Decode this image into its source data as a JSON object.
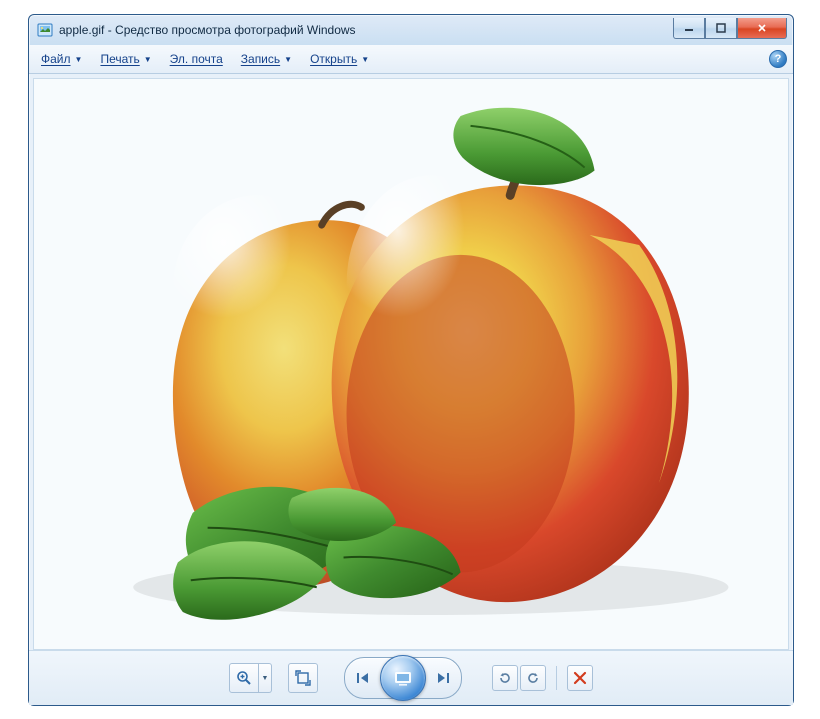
{
  "window": {
    "title": "apple.gif - Средство просмотра фотографий Windows"
  },
  "menu": {
    "file": "Файл",
    "print": "Печать",
    "email": "Эл. почта",
    "burn": "Запись",
    "open": "Открыть",
    "help_glyph": "?"
  },
  "image": {
    "description": "Two red-and-yellow apples with green leaves",
    "background_color": "#f7fbfd",
    "apple_red": "#d9482b",
    "apple_yellow": "#f0cf4a",
    "apple_orange": "#e28a2b",
    "leaf_green": "#3f8a2e",
    "leaf_dark": "#256016",
    "stem_brown": "#5a4026"
  },
  "toolbar": {
    "zoom_tooltip": "Изменить размер",
    "fit_tooltip": "По размеру окна",
    "prev_tooltip": "Предыдущее",
    "slideshow_tooltip": "Слайд-шоу",
    "next_tooltip": "Следующее",
    "rotate_ccw_tooltip": "Повернуть против часовой",
    "rotate_cw_tooltip": "Повернуть по часовой",
    "delete_tooltip": "Удалить"
  }
}
